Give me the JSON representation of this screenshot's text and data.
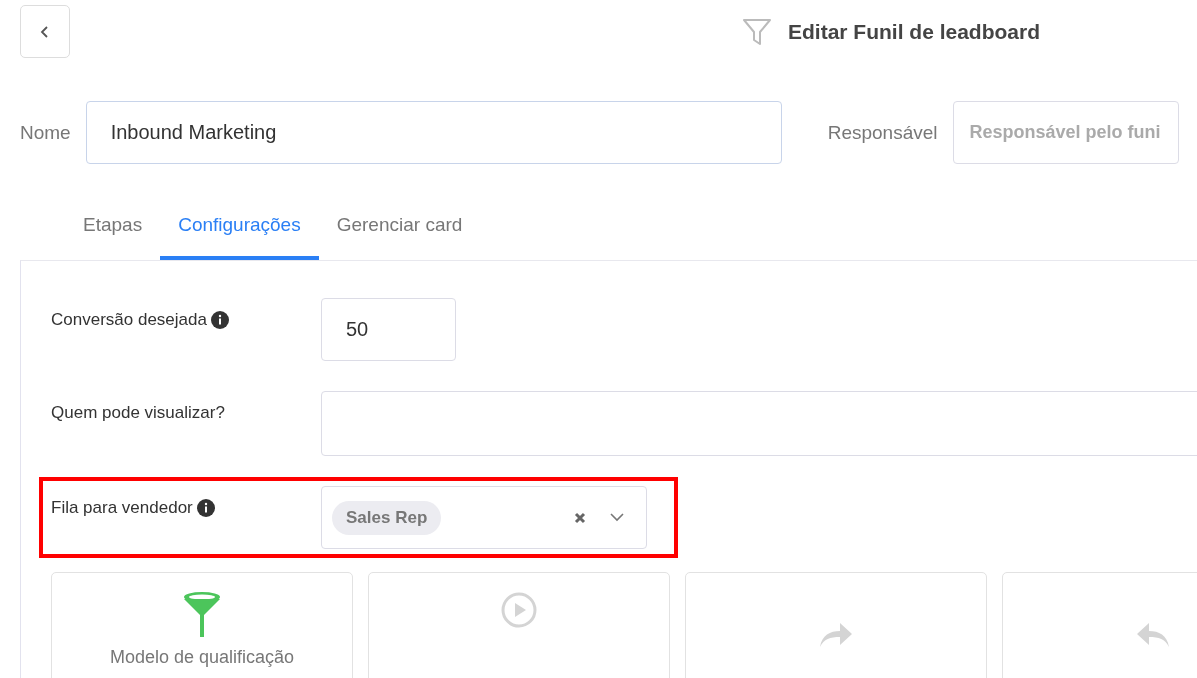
{
  "header": {
    "title": "Editar Funil de leadboard"
  },
  "fields": {
    "name_label": "Nome",
    "name_value": "Inbound Marketing",
    "owner_label": "Responsável",
    "owner_placeholder": "Responsável pelo funi"
  },
  "tabs": [
    {
      "label": "Etapas",
      "selected": false
    },
    {
      "label": "Configurações",
      "selected": true
    },
    {
      "label": "Gerenciar card",
      "selected": false
    }
  ],
  "settings": [
    {
      "kind": "number",
      "label": "Conversão desejada",
      "info": true,
      "value": "50"
    },
    {
      "kind": "text",
      "label": "Quem pode visualizar?",
      "info": false
    },
    {
      "kind": "select",
      "label": "Fila para vendedor",
      "info": true,
      "highlighted": true,
      "tags": [
        "Sales Rep"
      ]
    }
  ],
  "cards": [
    {
      "kind": "funnel",
      "label": "Modelo de qualificação"
    },
    {
      "kind": "play"
    },
    {
      "kind": "forward"
    },
    {
      "kind": "reply"
    }
  ]
}
